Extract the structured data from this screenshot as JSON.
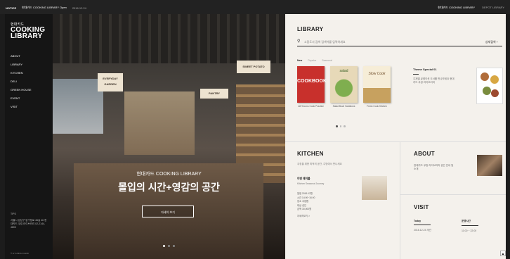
{
  "topbar": {
    "notice": "NOTICE",
    "promo": "현대카드 COOKING LIBRARY Open",
    "date": "2016.12.24",
    "right_link_1": "현대카드 COOKING LIBRARY",
    "right_link_2": "DEPOT LIBRARY"
  },
  "sidebar": {
    "logo_small": "현대카드",
    "logo_line_1": "COOKING",
    "logo_line_2": "LIBRARY",
    "nav": [
      "ABOUT",
      "LIBRARY",
      "KITCHEN",
      "DELI",
      "GREEN HOUSE",
      "EVENT",
      "VISIT"
    ],
    "footer_title": "TIPS",
    "footer_text": "서울시 강남구 압구정로 46길 46 현대카드 쿠킹 라이브러리 02-2144-4800",
    "copyright": "© HYUNDAI CARD"
  },
  "hero": {
    "subtitle": "현대카드 COOKING LIBRARY",
    "title": "몰입의 시간+영감의 공간",
    "button": "자세히 보기",
    "sign_1": "SWEET POTATO",
    "sign_2": "EVERYDAY GARDEN",
    "sign_3": "PANTRY"
  },
  "library": {
    "title": "LIBRARY",
    "search_placeholder": "소장도서 검색 검색어를 입력하세요",
    "advanced": "상세검색 +",
    "tabs": [
      "New",
      "Popular",
      "Seasonal"
    ],
    "books": [
      {
        "title": "COOKBOOK",
        "caption": "Jeff Koons Cook Practice"
      },
      {
        "title": "salad",
        "caption": "Salad Bowl Variations"
      },
      {
        "title": "Slow Cook",
        "caption": "Fresh Cook Kitchen"
      }
    ],
    "theme": {
      "title": "Theme Special 01",
      "desc": "주제별 큐레이션 도서를 만나보세요 현대카드 쿠킹 라이브러리"
    }
  },
  "kitchen": {
    "title": "KITCHEN",
    "desc": "쿠킹을 위한 최적의 공간, 주방에서 만나세요",
    "box_title": "이번 테이블",
    "box_sub": "Kitchen Seasonal Journey",
    "menu": [
      "일정 2016.12월",
      "시간 14:00~16:00",
      "장소 쿠킹랩",
      "대상 성인",
      "금액 30,000원"
    ],
    "more": "자세히보기 >"
  },
  "about": {
    "title": "ABOUT",
    "desc": "현대카드 쿠킹 라이브러리 공간 안내 및 소개"
  },
  "visit": {
    "title": "VISIT",
    "col1_head": "Today",
    "col1_val": "2016.12.24 개관",
    "col2_head": "운영시간",
    "col2_val": "11:00 ~ 22:00"
  },
  "colors": {
    "page_bg": "#f4f1ec",
    "sidebar_bg": "#151515",
    "accent": "#222222"
  }
}
